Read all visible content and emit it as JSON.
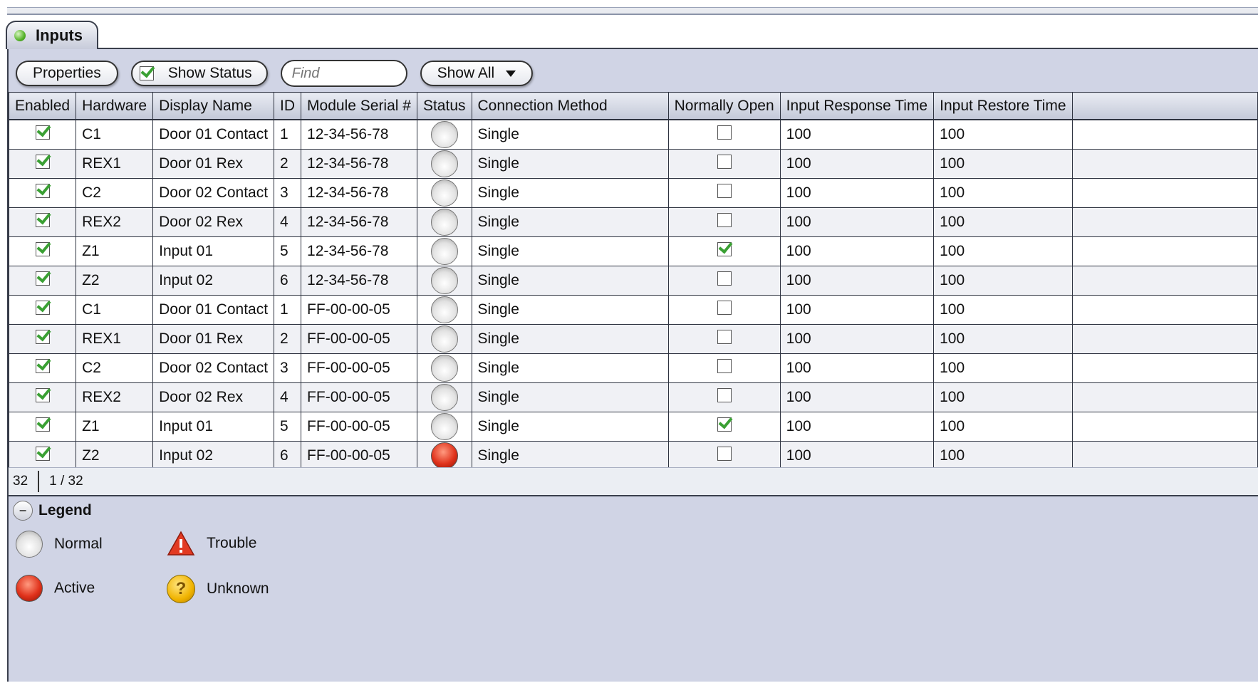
{
  "tab": {
    "label": "Inputs"
  },
  "toolbar": {
    "properties_label": "Properties",
    "show_status_label": "Show Status",
    "show_status_checked": true,
    "find_placeholder": "Find",
    "filter_value": "Show All"
  },
  "columns": [
    "Enabled",
    "Hardware",
    "Display Name",
    "ID",
    "Module Serial #",
    "Status",
    "Connection Method",
    "Normally Open",
    "Input Response Time",
    "Input Restore Time"
  ],
  "rows": [
    {
      "enabled": true,
      "hardware": "C1",
      "display_name": "Door 01 Contact",
      "id": "1",
      "serial": "12-34-56-78",
      "status": "normal",
      "connection": "Single",
      "normally_open": false,
      "response": "100",
      "restore": "100"
    },
    {
      "enabled": true,
      "hardware": "REX1",
      "display_name": "Door 01 Rex",
      "id": "2",
      "serial": "12-34-56-78",
      "status": "normal",
      "connection": "Single",
      "normally_open": false,
      "response": "100",
      "restore": "100"
    },
    {
      "enabled": true,
      "hardware": "C2",
      "display_name": "Door 02 Contact",
      "id": "3",
      "serial": "12-34-56-78",
      "status": "normal",
      "connection": "Single",
      "normally_open": false,
      "response": "100",
      "restore": "100"
    },
    {
      "enabled": true,
      "hardware": "REX2",
      "display_name": "Door 02 Rex",
      "id": "4",
      "serial": "12-34-56-78",
      "status": "normal",
      "connection": "Single",
      "normally_open": false,
      "response": "100",
      "restore": "100"
    },
    {
      "enabled": true,
      "hardware": "Z1",
      "display_name": "Input 01",
      "id": "5",
      "serial": "12-34-56-78",
      "status": "normal",
      "connection": "Single",
      "normally_open": true,
      "response": "100",
      "restore": "100"
    },
    {
      "enabled": true,
      "hardware": "Z2",
      "display_name": "Input 02",
      "id": "6",
      "serial": "12-34-56-78",
      "status": "normal",
      "connection": "Single",
      "normally_open": false,
      "response": "100",
      "restore": "100"
    },
    {
      "enabled": true,
      "hardware": "C1",
      "display_name": "Door 01 Contact",
      "id": "1",
      "serial": "FF-00-00-05",
      "status": "normal",
      "connection": "Single",
      "normally_open": false,
      "response": "100",
      "restore": "100"
    },
    {
      "enabled": true,
      "hardware": "REX1",
      "display_name": "Door 01 Rex",
      "id": "2",
      "serial": "FF-00-00-05",
      "status": "normal",
      "connection": "Single",
      "normally_open": false,
      "response": "100",
      "restore": "100"
    },
    {
      "enabled": true,
      "hardware": "C2",
      "display_name": "Door 02 Contact",
      "id": "3",
      "serial": "FF-00-00-05",
      "status": "normal",
      "connection": "Single",
      "normally_open": false,
      "response": "100",
      "restore": "100"
    },
    {
      "enabled": true,
      "hardware": "REX2",
      "display_name": "Door 02 Rex",
      "id": "4",
      "serial": "FF-00-00-05",
      "status": "normal",
      "connection": "Single",
      "normally_open": false,
      "response": "100",
      "restore": "100"
    },
    {
      "enabled": true,
      "hardware": "Z1",
      "display_name": "Input 01",
      "id": "5",
      "serial": "FF-00-00-05",
      "status": "normal",
      "connection": "Single",
      "normally_open": true,
      "response": "100",
      "restore": "100"
    },
    {
      "enabled": true,
      "hardware": "Z2",
      "display_name": "Input 02",
      "id": "6",
      "serial": "FF-00-00-05",
      "status": "active",
      "connection": "Single",
      "normally_open": false,
      "response": "100",
      "restore": "100"
    }
  ],
  "statusbar": {
    "total": "32",
    "position": "1 / 32"
  },
  "legend": {
    "title": "Legend",
    "normal": "Normal",
    "active": "Active",
    "trouble": "Trouble",
    "unknown": "Unknown"
  },
  "colors": {
    "panel": "#d0d4e5",
    "active_red": "#e0321b",
    "check_green": "#3aa033"
  }
}
